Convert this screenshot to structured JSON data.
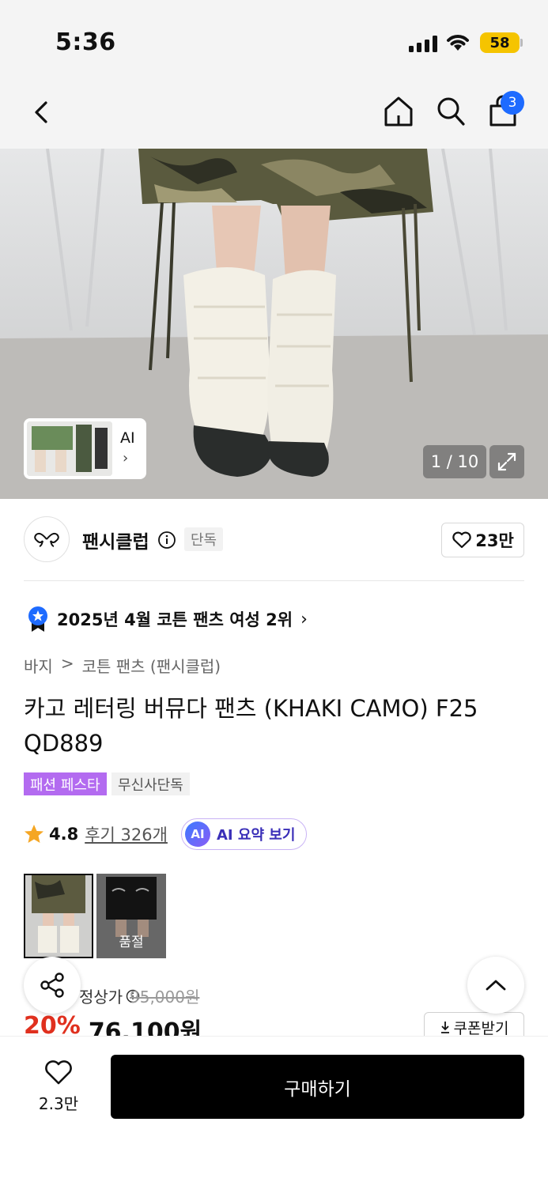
{
  "status": {
    "time": "5:36",
    "battery": "58"
  },
  "nav": {
    "cart_count": "3"
  },
  "hero": {
    "thumb_label": "AI",
    "thumb_arrow": "›",
    "counter": "1 / 10"
  },
  "brand": {
    "name": "팬시클럽",
    "tag": "단독",
    "likes": "23만"
  },
  "rank": {
    "text": "2025년 4월 코튼 팬츠 여성 2위"
  },
  "breadcrumb": {
    "category": "바지",
    "sep": ">",
    "sub": "코튼 팬츠 (팬시클럽)"
  },
  "product": {
    "title": "카고 레터링 버뮤다 팬츠 (KHAKI CAMO) F25 QD889",
    "tags": [
      "패션 페스타",
      "무신사단독"
    ]
  },
  "rating": {
    "score": "4.8",
    "reviews": "후기 326개",
    "ai_badge": "AI",
    "ai_summary": "AI 요약 보기"
  },
  "options": {
    "soldout_label": "품절"
  },
  "price": {
    "label": "정상가",
    "original": "95,000원",
    "discount": "20%",
    "final": "76,100원",
    "coupon": "쿠폰받기"
  },
  "bottom": {
    "wish_count": "2.3만",
    "buy_label": "구매하기"
  },
  "colors": {
    "accent_blue": "#1e6bff",
    "sale_red": "#e0301e",
    "fest_purple": "#b36bf0",
    "battery_yellow": "#f5c400"
  }
}
